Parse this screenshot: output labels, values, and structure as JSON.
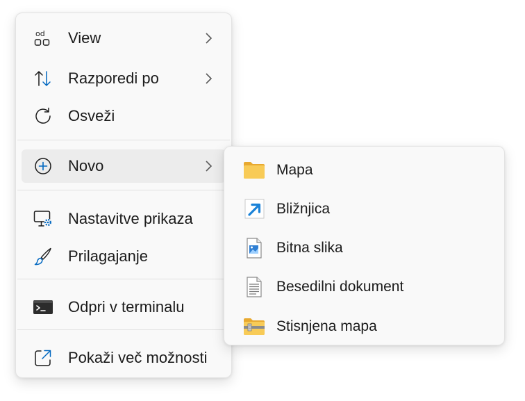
{
  "context_menu": {
    "items": [
      {
        "label": "View",
        "icon": "view-icon",
        "has_submenu": true
      },
      {
        "label": "Razporedi po",
        "icon": "sort-icon",
        "has_submenu": true
      },
      {
        "label": "Osveži",
        "icon": "refresh-icon",
        "has_submenu": false
      },
      {
        "label": "Novo",
        "icon": "add-icon",
        "has_submenu": true,
        "highlighted": true
      },
      {
        "label": "Nastavitve prikaza",
        "icon": "display-settings-icon",
        "has_submenu": false
      },
      {
        "label": "Prilagajanje",
        "icon": "brush-icon",
        "has_submenu": false
      },
      {
        "label": "Odpri v terminalu",
        "icon": "terminal-icon",
        "has_submenu": false
      },
      {
        "label": "Pokaži več možnosti",
        "icon": "more-options-icon",
        "has_submenu": false
      }
    ],
    "view_icon_text": "od"
  },
  "new_submenu": {
    "items": [
      {
        "label": "Mapa",
        "icon": "folder-icon"
      },
      {
        "label": "Bližnjica",
        "icon": "shortcut-icon"
      },
      {
        "label": "Bitna slika",
        "icon": "bitmap-icon"
      },
      {
        "label": "Besedilni dokument",
        "icon": "text-document-icon"
      },
      {
        "label": "Stisnjena mapa",
        "icon": "zip-folder-icon"
      }
    ]
  },
  "colors": {
    "accent": "#0067c0",
    "folder": "#f5c24a",
    "menu_bg": "#f9f9f9",
    "hover_bg": "#ececec"
  }
}
